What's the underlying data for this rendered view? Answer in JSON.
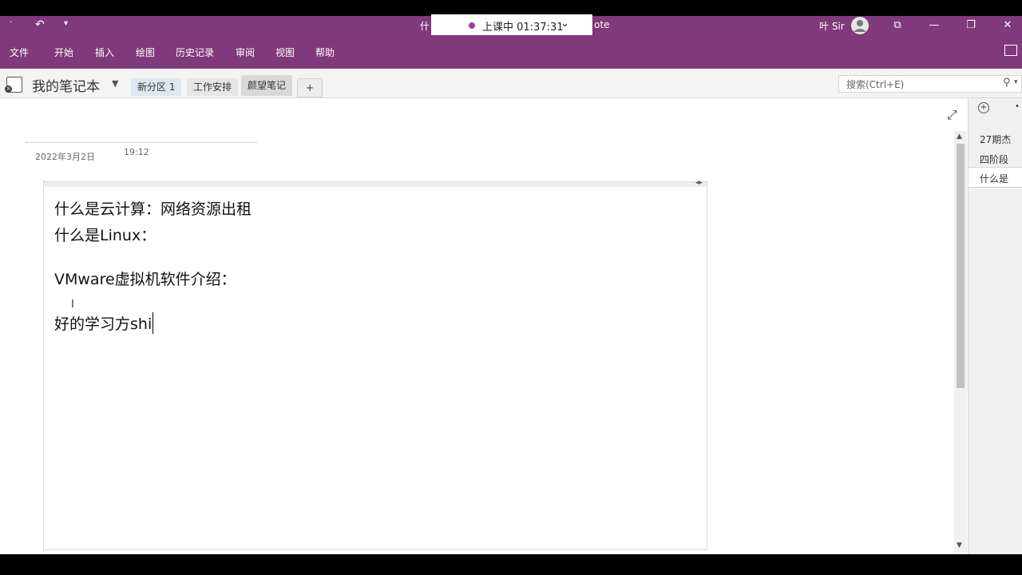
{
  "title_bar": {
    "title_left": "什",
    "title_right": "ote",
    "timer_label": "上课中 01:37:31",
    "timer_chevron": "⌄",
    "user_name": "叶 Sir",
    "undo_icon": "undo-icon",
    "qat_dropdown_icon": "dropdown-icon"
  },
  "menu": {
    "items": [
      "文件",
      "开始",
      "插入",
      "绘图",
      "历史记录",
      "审阅",
      "视图",
      "帮助"
    ]
  },
  "notebook": {
    "name": "我的笔记本",
    "sections": [
      "新分区 1",
      "工作安排",
      "颜望笔记"
    ],
    "add_section": "+",
    "search_placeholder": "搜索(Ctrl+E)"
  },
  "page": {
    "date": "2022年3月2日",
    "time": "19:12",
    "lines": [
      "什么是云计算：网络资源出租",
      "什么是Linux：",
      "VMware虚拟机软件介绍：",
      "好的学习方shi"
    ]
  },
  "page_list": {
    "items": [
      "27期杰",
      "四阶段",
      "什么是"
    ]
  },
  "colors": {
    "brand": "#80397b",
    "background": "#ffffff"
  }
}
